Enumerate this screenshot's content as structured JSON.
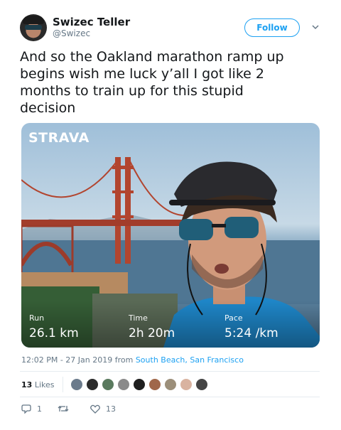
{
  "user": {
    "name": "Swizec Teller",
    "handle": "@Swizec"
  },
  "follow_label": "Follow",
  "tweet": {
    "lines": [
      "And so the Oakland marathon ramp up",
      "begins wish me luck y’all I got like 2",
      "months to train up for this stupid",
      "decision"
    ]
  },
  "media": {
    "brand": "STRAVA",
    "stats": [
      {
        "label": "Run",
        "value": "26.1 km"
      },
      {
        "label": "Time",
        "value": "2h 20m"
      },
      {
        "label": "Pace",
        "value": "5:24 /km"
      }
    ]
  },
  "meta": {
    "time": "12:02 PM - 27 Jan 2019 from",
    "location": "South Beach, San Francisco"
  },
  "likes": {
    "count": "13",
    "label": "Likes"
  },
  "fav_avatars": [
    {
      "color": "#6b7b8c"
    },
    {
      "color": "#2b2b2b"
    },
    {
      "color": "#5a7a5e"
    },
    {
      "color": "#8a8a8a"
    },
    {
      "color": "#1f1f1f"
    },
    {
      "color": "#a0674a"
    },
    {
      "color": "#9c8f7a"
    },
    {
      "color": "#d9b3a0"
    },
    {
      "color": "#444444"
    }
  ],
  "actions": {
    "reply_count": "1",
    "retweet_count": "",
    "like_count": "13"
  },
  "colors": {
    "accent": "#1da1f2",
    "secondary_text": "#657786"
  }
}
